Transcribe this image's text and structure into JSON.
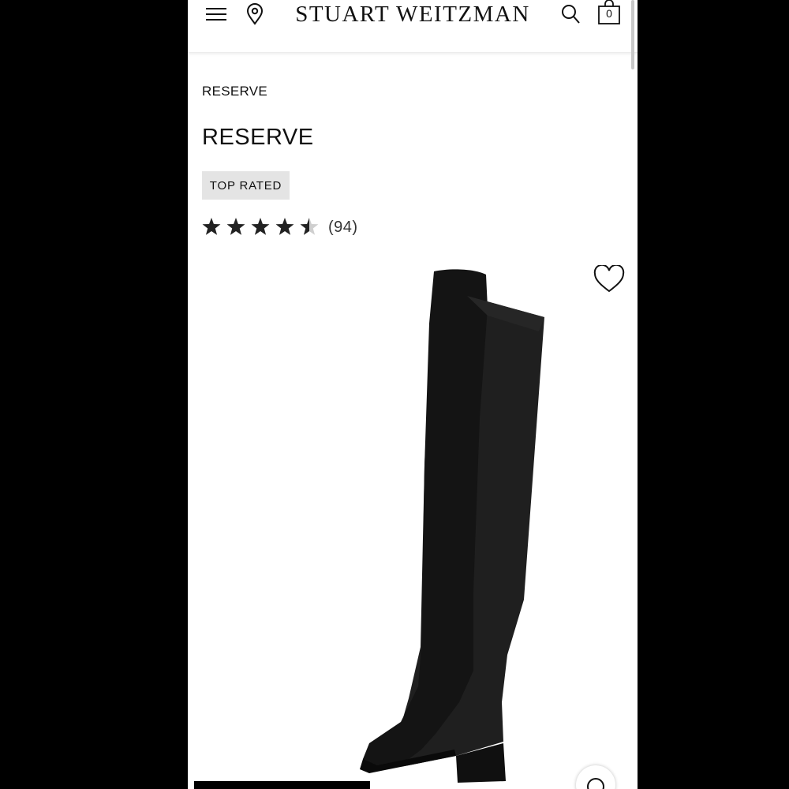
{
  "header": {
    "brand": "STUART WEITZMAN",
    "bag_count": "0",
    "icons": [
      "menu-icon",
      "location-pin-icon",
      "search-icon",
      "shopping-bag-icon"
    ]
  },
  "product": {
    "breadcrumb": "RESERVE",
    "title": "RESERVE",
    "badge": "TOP RATED",
    "rating": 4.5,
    "rating_max": 5,
    "review_count": "(94)"
  },
  "icons": {
    "wishlist": "heart-icon",
    "zoom": "zoom-icon"
  },
  "colors": {
    "text": "#111111",
    "badge_bg": "#e4e4e4",
    "star_filled": "#222222",
    "star_empty": "#cfcfcf"
  }
}
